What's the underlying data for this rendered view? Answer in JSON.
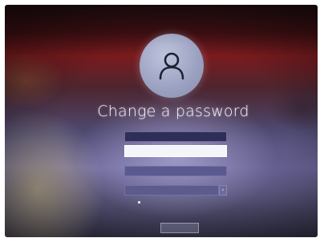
{
  "screen": {
    "title": "Change a password"
  },
  "form": {
    "username_value": "",
    "old_password_placeholder": "",
    "new_password_placeholder": "",
    "confirm_password_placeholder": ""
  },
  "links": {
    "create_reset_disk": ""
  },
  "buttons": {
    "cancel_label": ""
  },
  "icons": {
    "avatar": "user-icon",
    "submit": "arrow-right-icon"
  }
}
